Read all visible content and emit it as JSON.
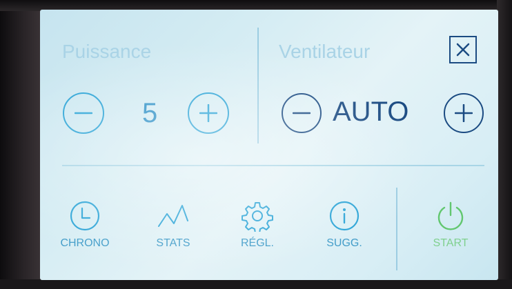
{
  "power": {
    "title": "Puissance",
    "value": "5",
    "decrease_icon": "minus-circle-icon",
    "increase_icon": "plus-circle-icon"
  },
  "fan": {
    "title": "Ventilateur",
    "value": "AUTO",
    "decrease_icon": "minus-circle-icon",
    "increase_icon": "plus-circle-icon"
  },
  "close": {
    "icon": "close-icon"
  },
  "nav": {
    "items": [
      {
        "label": "CHRONO",
        "icon": "clock-icon"
      },
      {
        "label": "STATS",
        "icon": "line-chart-icon"
      },
      {
        "label": "RÉGL.",
        "icon": "gear-icon"
      },
      {
        "label": "SUGG.",
        "icon": "info-icon"
      }
    ],
    "start": {
      "label": "START",
      "icon": "power-icon"
    }
  },
  "colors": {
    "accent": "#29a3d6",
    "dark_accent": "#1b4b82",
    "title_muted": "#a9d3e6",
    "start_green": "#7fd08e",
    "screen_background": "#d4ecf3"
  }
}
